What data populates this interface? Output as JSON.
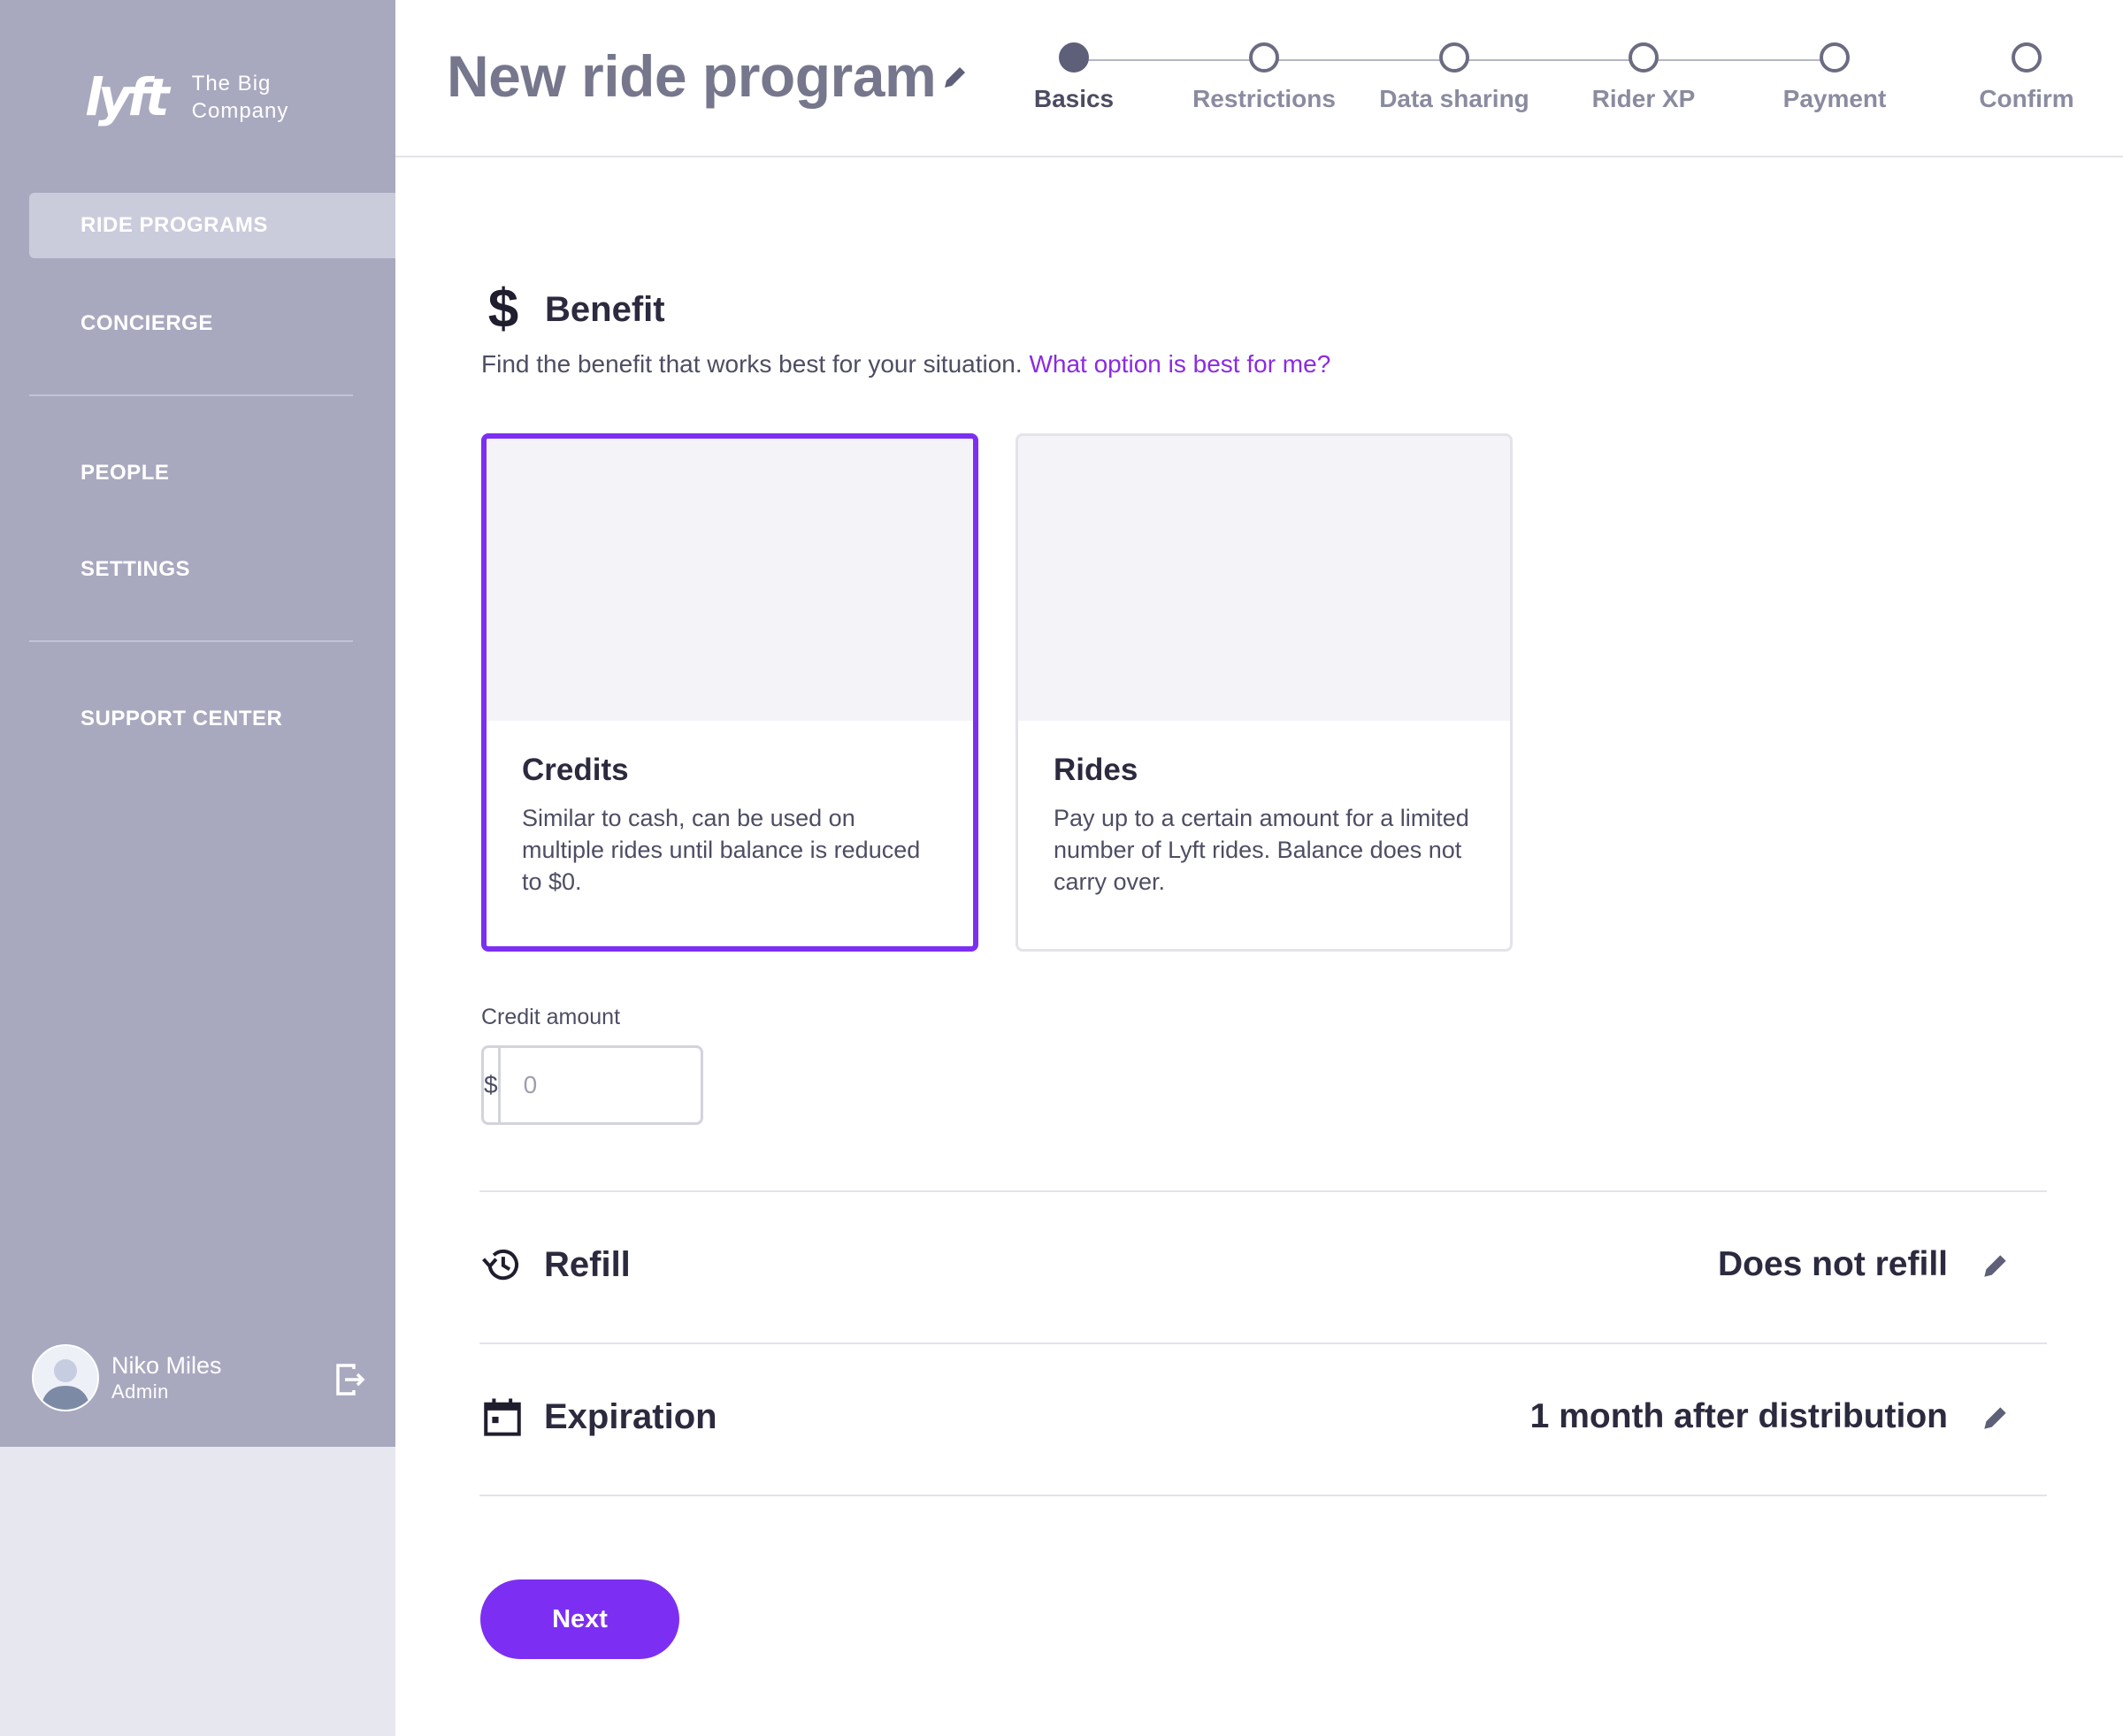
{
  "brand": {
    "logo": "lyft",
    "company_line1": "The Big",
    "company_line2": "Company"
  },
  "sidebar": {
    "items": [
      {
        "label": "RIDE PROGRAMS",
        "active": true
      },
      {
        "label": "CONCIERGE",
        "active": false
      },
      {
        "label": "PEOPLE",
        "active": false
      },
      {
        "label": "SETTINGS",
        "active": false
      },
      {
        "label": "SUPPORT CENTER",
        "active": false
      }
    ],
    "user": {
      "name": "Niko Miles",
      "role": "Admin"
    }
  },
  "header": {
    "title": "New ride program",
    "steps": [
      {
        "label": "Basics",
        "state": "current"
      },
      {
        "label": "Restrictions",
        "state": "upcoming"
      },
      {
        "label": "Data sharing",
        "state": "upcoming"
      },
      {
        "label": "Rider XP",
        "state": "upcoming"
      },
      {
        "label": "Payment",
        "state": "upcoming"
      },
      {
        "label": "Confirm",
        "state": "upcoming"
      }
    ]
  },
  "benefit": {
    "title": "Benefit",
    "subtitle": "Find the benefit that works best for your situation.",
    "help_link": "What option is best for me?",
    "options": [
      {
        "title": "Credits",
        "description": "Similar to cash, can be used on multiple rides until balance is reduced to $0.",
        "selected": true
      },
      {
        "title": "Rides",
        "description": "Pay up to a certain amount for a limited number of Lyft rides. Balance does not carry over.",
        "selected": false
      }
    ],
    "credit_amount": {
      "label": "Credit amount",
      "prefix": "$",
      "placeholder": "0",
      "value": ""
    }
  },
  "refill": {
    "title": "Refill",
    "value": "Does not refill"
  },
  "expiration": {
    "title": "Expiration",
    "value": "1 month after distribution"
  },
  "actions": {
    "next_label": "Next"
  },
  "colors": {
    "accent": "#7c2ff2",
    "link": "#8a2be2",
    "sidebar_bg": "#a8a9bf",
    "sidebar_active": "#cacbdb"
  }
}
